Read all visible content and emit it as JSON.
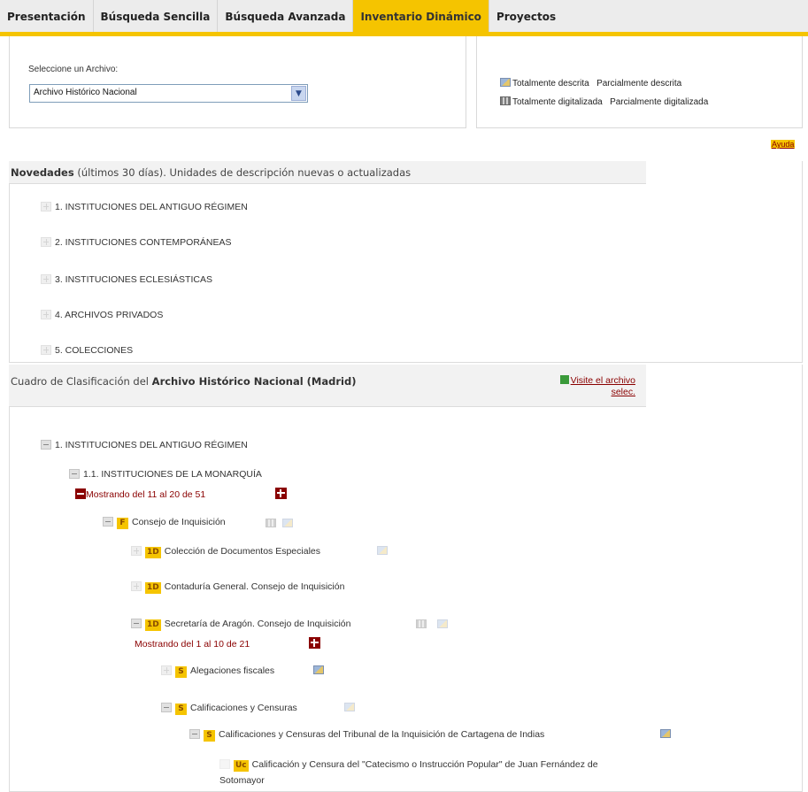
{
  "tabs": [
    {
      "label": "Presentación",
      "active": false
    },
    {
      "label": "Búsqueda Sencilla",
      "active": false
    },
    {
      "label": "Búsqueda Avanzada",
      "active": false
    },
    {
      "label": "Inventario Dinámico",
      "active": true
    },
    {
      "label": "Proyectos",
      "active": false
    }
  ],
  "selector": {
    "label": "Seleccione un Archivo:",
    "value": "Archivo Histórico Nacional"
  },
  "legend": {
    "fully_described": "Totalmente descrita",
    "partially_described": "Parcialmente descrita",
    "fully_digitized": "Totalmente digitalizada",
    "partially_digitized": "Parcialmente digitalizada"
  },
  "help_link": "Ayuda",
  "novedades": {
    "title_bold": "Novedades",
    "title_rest": " (últimos 30 días). Unidades de descripción nuevas o actualizadas",
    "items": [
      "1. INSTITUCIONES DEL ANTIGUO RÉGIMEN",
      "2. INSTITUCIONES CONTEMPORÁNEAS",
      "3. INSTITUCIONES ECLESIÁSTICAS",
      "4. ARCHIVOS PRIVADOS",
      "5. COLECCIONES"
    ]
  },
  "cuadro": {
    "title_prefix": "Cuadro de Clasificación del ",
    "title_bold": "Archivo Histórico Nacional (Madrid)",
    "visit_link_line1": "Visite el archivo",
    "visit_link_line2": "selec."
  },
  "tree": {
    "level1": "1. INSTITUCIONES DEL ANTIGUO RÉGIMEN",
    "level2": "1.1. INSTITUCIONES DE LA MONARQUÍA",
    "pager1": "Mostrando del 11 al 20 de 51",
    "fondo": {
      "badge": "F",
      "label": "Consejo de Inquisición"
    },
    "d1": {
      "badge": "1D",
      "label": "Colección de Documentos Especiales"
    },
    "d2": {
      "badge": "1D",
      "label": "Contaduría General. Consejo de Inquisición"
    },
    "d3": {
      "badge": "1D",
      "label": "Secretaría de Aragón. Consejo de Inquisición"
    },
    "pager2": "Mostrando del 1 al 10 de 21",
    "s1": {
      "badge": "S",
      "label": "Alegaciones fiscales"
    },
    "s2": {
      "badge": "S",
      "label": "Calificaciones y Censuras"
    },
    "s3": {
      "badge": "S",
      "label": "Calificaciones y Censuras del Tribunal de la Inquisición de Cartagena de Indias"
    },
    "uc": {
      "badge": "Uc",
      "label_line1": "Calificación y Censura del \"Catecismo o Instrucción Popular\" de Juan Fernández de",
      "label_line2": "Sotomayor"
    }
  }
}
